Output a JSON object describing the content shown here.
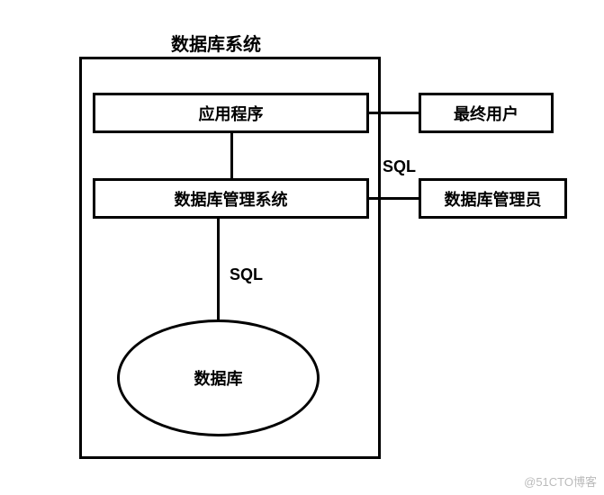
{
  "diagram": {
    "title": "数据库系统",
    "nodes": {
      "application": "应用程序",
      "dbms": "数据库管理系统",
      "database": "数据库",
      "end_user": "最终用户",
      "dba": "数据库管理员"
    },
    "edge_labels": {
      "user_sql": "SQL",
      "db_sql": "SQL"
    }
  },
  "watermark": "@51CTO博客"
}
